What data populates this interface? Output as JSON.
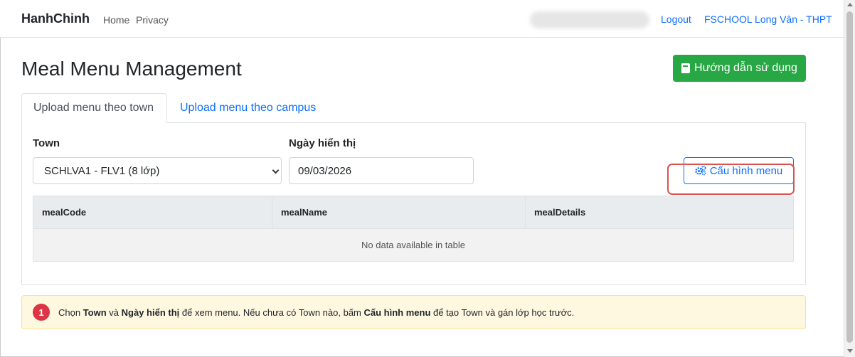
{
  "navbar": {
    "brand": "HanhChinh",
    "home_label": "Home",
    "privacy_label": "Privacy",
    "logout_label": "Logout",
    "school_label": "FSCHOOL Long Vân - THPT"
  },
  "page": {
    "title": "Meal Menu Management",
    "guide_button": "Hướng dẫn sử dụng"
  },
  "tabs": [
    {
      "label": "Upload menu theo town",
      "active": true
    },
    {
      "label": "Upload menu theo campus",
      "active": false
    }
  ],
  "form": {
    "town_label": "Town",
    "town_value": "SCHLVA1 - FLV1 (8 lớp)",
    "date_label": "Ngày hiển thị",
    "date_value": "09/03/2026",
    "config_button": "Cấu hình menu"
  },
  "table": {
    "columns": [
      "mealCode",
      "mealName",
      "mealDetails"
    ],
    "empty_text": "No data available in table"
  },
  "alert": {
    "badge": "1",
    "part1": "Chọn ",
    "town": "Town",
    "part2": " và ",
    "date": "Ngày hiển thị",
    "part3": " để xem menu. Nếu chưa có Town nào, bấm ",
    "config": "Cấu hình menu",
    "part4": " để tạo Town và gán lớp học trước."
  },
  "colors": {
    "primary": "#0d6efd",
    "success": "#28a745",
    "danger": "#dc3545",
    "highlight": "#d9534f",
    "alert_bg": "#fff8e1"
  },
  "icons": {
    "guide": "book-icon",
    "config": "gear-icon",
    "select": "chevron-down-icon"
  }
}
